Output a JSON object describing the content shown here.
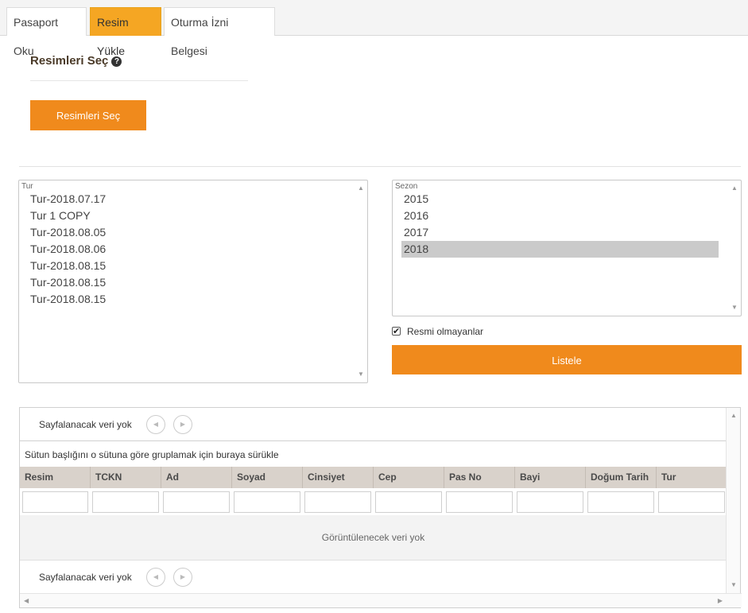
{
  "tabs": [
    {
      "label": "Pasaport Oku",
      "active": false
    },
    {
      "label": "Resim Yükle",
      "active": true
    },
    {
      "label": "Oturma İzni Belgesi",
      "active": false
    }
  ],
  "upload": {
    "title": "Resimleri Seç",
    "button_label": "Resimleri Seç"
  },
  "tur_list": {
    "legend": "Tur",
    "items": [
      "Tur-2018.07.17",
      "Tur 1 COPY",
      "Tur-2018.08.05",
      "Tur-2018.08.06",
      "Tur-2018.08.15",
      "Tur-2018.08.15",
      "Tur-2018.08.15"
    ]
  },
  "sezon_list": {
    "legend": "Sezon",
    "items": [
      "2015",
      "2016",
      "2017",
      "2018"
    ],
    "selected": "2018"
  },
  "filter": {
    "checkbox_label": "Resmi olmayanlar",
    "checked": true,
    "listele_label": "Listele"
  },
  "grid": {
    "pager_text": "Sayfalanacak veri yok",
    "group_panel_text": "Sütun başlığını o sütuna göre gruplamak için buraya sürükle",
    "columns": [
      "Resim",
      "TCKN",
      "Ad",
      "Soyad",
      "Cinsiyet",
      "Cep",
      "Pas No",
      "Bayi",
      "Doğum Tarih",
      "Tur"
    ],
    "empty_text": "Görüntülenecek veri yok"
  },
  "colors": {
    "accent": "#f08a1c",
    "active_tab": "#f5a623",
    "header_bg": "#d9d2cb"
  }
}
